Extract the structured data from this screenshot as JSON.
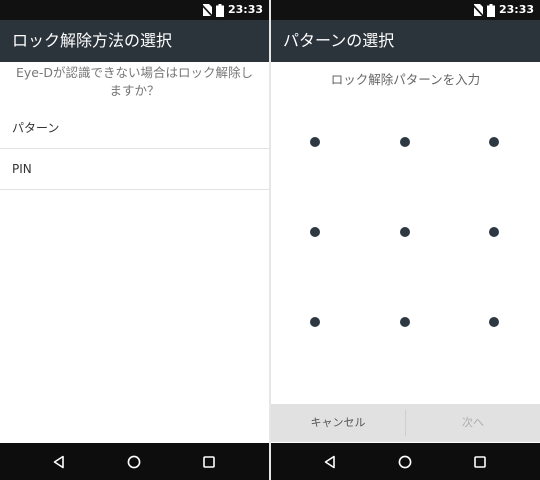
{
  "status_bar": {
    "time": "23:33"
  },
  "left_screen": {
    "title": "ロック解除方法の選択",
    "prompt_line1": "Eye-Dが認識できない場合はロック解除し",
    "prompt_line2": "ますか？",
    "options": [
      {
        "label": "パターン"
      },
      {
        "label": "PIN"
      }
    ]
  },
  "right_screen": {
    "title": "パターンの選択",
    "instruction": "ロック解除パターンを入力",
    "cancel_label": "キャンセル",
    "next_label": "次へ"
  },
  "colors": {
    "app_bar": "#2b333b",
    "status_bar": "#111111",
    "nav_bar": "#0d0d0d",
    "pattern_dot": "#2d3843",
    "button_bar": "#e1e1e1"
  },
  "icons": {
    "status": [
      "no-sim-icon",
      "battery-icon"
    ],
    "navigation": [
      "back-icon",
      "home-icon",
      "recents-icon"
    ]
  }
}
